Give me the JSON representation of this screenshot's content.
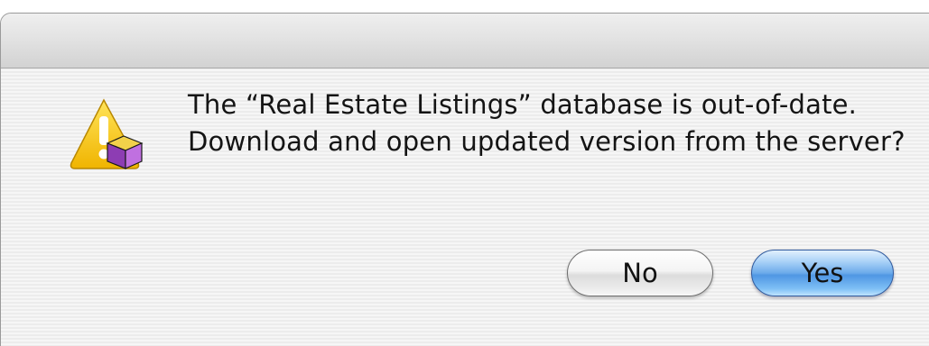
{
  "dialog": {
    "icon": "caution-alert-icon",
    "badge": "database-cube-icon",
    "message": "The “Real Estate Listings” database is out-of-date. Download and open updated version from the server?"
  },
  "buttons": {
    "no_label": "No",
    "yes_label": "Yes"
  },
  "colors": {
    "default_button": "#5a9fe6",
    "warning_triangle": "#f5c400",
    "badge_cube": "#a64fc7"
  }
}
